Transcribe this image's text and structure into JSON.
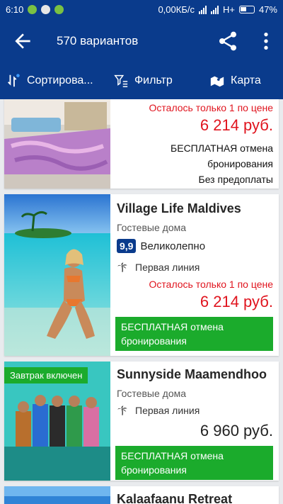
{
  "status": {
    "time": "6:10",
    "net": "0,00КБ/с",
    "network": "H+",
    "battery": "47%"
  },
  "appbar": {
    "title": "570 вариантов",
    "back_icon": "arrow-left-icon",
    "share_icon": "share-icon",
    "more_icon": "more-vertical-icon"
  },
  "toolbar": {
    "sort": "Сортирова...",
    "filter": "Фильтр",
    "map": "Карта"
  },
  "cards": [
    {
      "left_message": "Осталось только 1 по цене",
      "price": "6 214 руб.",
      "free_cancel": "БЕСПЛАТНАЯ отмена",
      "free_cancel_2": "бронирования",
      "no_prepay": "Без предоплаты"
    },
    {
      "name": "Village Life Maldives",
      "type": "Гостевые дома",
      "score": "9,9",
      "rating": "Великолепно",
      "beach": "Первая линия",
      "left_message": "Осталось только 1 по цене",
      "price": "6 214 руб.",
      "free_cancel": "БЕСПЛАТНАЯ отмена",
      "free_cancel_2": "бронирования"
    },
    {
      "badge": "Завтрак включен",
      "name": "Sunnyside Maamendhoo",
      "type": "Гостевые дома",
      "beach": "Первая линия",
      "price": "6 960 руб.",
      "free_cancel": "БЕСПЛАТНАЯ отмена",
      "free_cancel_2": "бронирования"
    },
    {
      "name": "Kalaafaanu Retreat"
    }
  ]
}
